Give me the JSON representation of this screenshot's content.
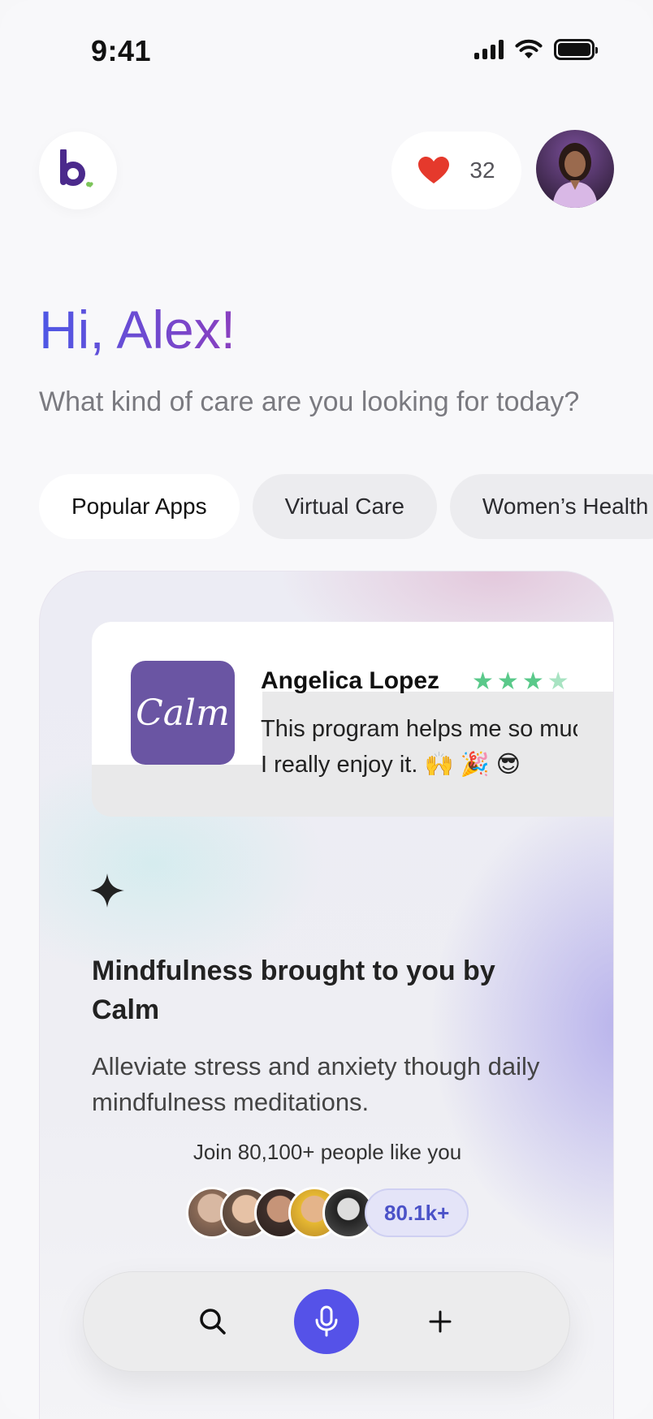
{
  "status_bar": {
    "time": "9:41"
  },
  "header": {
    "likes_count": "32"
  },
  "greeting": {
    "title": "Hi, Alex!",
    "subtitle": "What kind of care are you looking for today?"
  },
  "chips": [
    {
      "label": "Popular Apps",
      "active": true
    },
    {
      "label": "Virtual Care",
      "active": false
    },
    {
      "label": "Women’s Health",
      "active": false
    }
  ],
  "featured": {
    "review": {
      "app_logo_text": "Calm",
      "reviewer": "Angelica Lopez",
      "rating": 4.5,
      "line1": "This program helps me so much.",
      "line2": "I really enjoy it. 🙌 🎉 😎"
    },
    "title": "Mindfulness brought to you by Calm",
    "description": "Alleviate stress and anxiety though daily mindfulness meditations.",
    "join_text": "Join 80,100+ people like you",
    "people_count": "80.1k+"
  },
  "colors": {
    "accent": "#5552e8",
    "heart": "#e5392c",
    "star": "#5ac98a",
    "calm_brand": "#6a55a3"
  },
  "tab_bar": {
    "items": [
      {
        "icon": "search-icon"
      },
      {
        "icon": "microphone-icon"
      },
      {
        "icon": "plus-icon"
      }
    ]
  }
}
